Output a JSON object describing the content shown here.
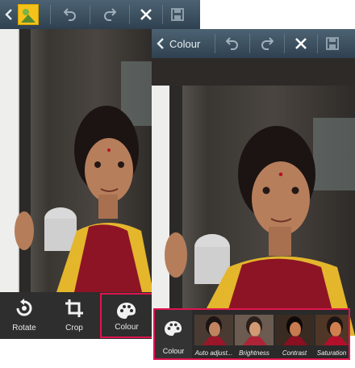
{
  "left_panel": {
    "toolbar": {
      "back_icon": "chevron-left-icon",
      "thumbnail_icon": "image-thumbnail-icon",
      "undo_icon": "undo-icon",
      "redo_icon": "redo-icon",
      "close_icon": "close-icon",
      "save_icon": "save-icon"
    },
    "tools": [
      {
        "label": "Rotate",
        "icon": "rotate-icon"
      },
      {
        "label": "Crop",
        "icon": "crop-icon"
      },
      {
        "label": "Colour",
        "icon": "palette-icon",
        "selected": true
      }
    ]
  },
  "right_panel": {
    "toolbar": {
      "title": "Colour",
      "back_icon": "chevron-left-icon",
      "undo_icon": "undo-icon",
      "redo_icon": "redo-icon",
      "close_icon": "close-icon",
      "save_icon": "save-icon"
    },
    "colour_button_label": "Colour",
    "filters": [
      {
        "label": "Auto adjust..."
      },
      {
        "label": "Brightness"
      },
      {
        "label": "Contrast"
      },
      {
        "label": "Saturation"
      }
    ]
  },
  "colors": {
    "highlight": "#e0144f",
    "toolbar": "#3c5060",
    "bottombar": "#2e2e2e"
  }
}
